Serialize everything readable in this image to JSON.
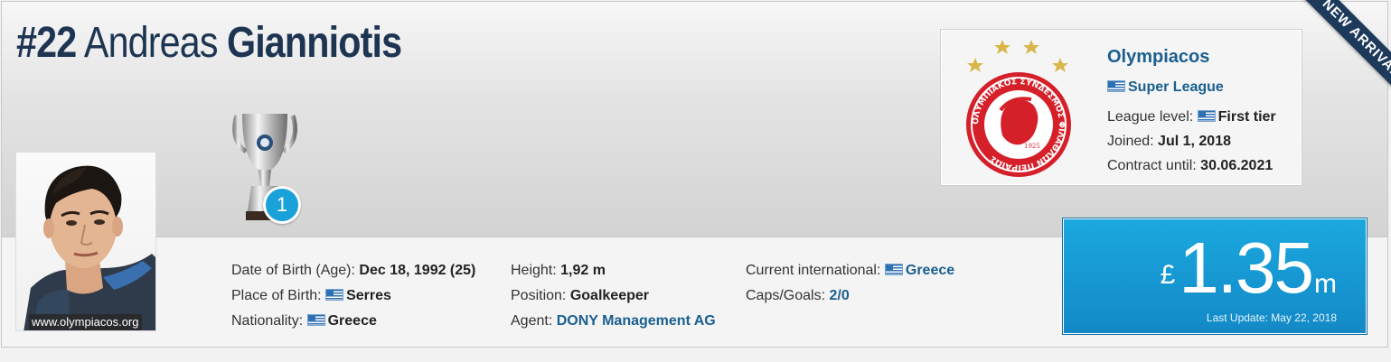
{
  "player": {
    "number": "#22",
    "first_name": "Andreas",
    "last_name": "Gianniotis",
    "photo_credit": "www.olympiacos.org"
  },
  "trophies": {
    "count": "1"
  },
  "info": {
    "col1": [
      {
        "label": "Date of Birth (Age):",
        "value": "Dec 18, 1992 (25)"
      },
      {
        "label": "Place of Birth:",
        "value": "Serres",
        "flag": "greece-flag"
      },
      {
        "label": "Nationality:",
        "value": "Greece",
        "flag": "greece-flag"
      }
    ],
    "col2": [
      {
        "label": "Height:",
        "value": "1,92 m"
      },
      {
        "label": "Position:",
        "value": "Goalkeeper"
      },
      {
        "label": "Agent:",
        "value": "DONY Management AG"
      }
    ],
    "col3": [
      {
        "label": "Current international:",
        "value": "Greece",
        "flag": "greece-flag"
      },
      {
        "label": "Caps/Goals:",
        "value": "2/0"
      }
    ]
  },
  "club": {
    "name": "Olympiacos",
    "league": "Super League",
    "league_level_label": "League level:",
    "league_level": "First tier",
    "joined_label": "Joined:",
    "joined": "Jul 1, 2018",
    "contract_label": "Contract until:",
    "contract": "30.06.2021",
    "logo_text": "ΟΛΥΜΠΙΑΚΟΣ ΣΥΝΔΕΣΜΟΣ ΦΙΛΑΘΛΩΝ ΠΕΙΡΑΙΩΣ",
    "logo_year": "1925"
  },
  "ribbon": {
    "label": "NEW ARRIVAL"
  },
  "market_value": {
    "currency": "£",
    "amount": "1.35",
    "unit": "m",
    "update": "Last Update: May 22, 2018"
  },
  "colors": {
    "title": "#1d3552",
    "link": "#1a5f8f",
    "value_box": "#1ba8df",
    "ribbon": "#1d3a5b",
    "club_red": "#d5202a"
  }
}
